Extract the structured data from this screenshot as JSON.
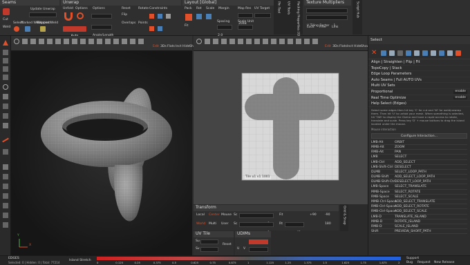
{
  "top": {
    "seams": {
      "title": "Seams",
      "labels": [
        "Cut",
        "Update Unwrap",
        "Disabled",
        "Weld",
        "Select",
        "Marked Weld",
        "Mapped Weld"
      ]
    },
    "unwrap": {
      "title": "Unwrap",
      "labels": [
        "Unfold",
        "Options",
        "Options",
        "Auto",
        "Angle/Length",
        "Reset",
        "Flip",
        "Overlaps",
        "Rotate",
        "Points",
        "Constraints"
      ]
    },
    "layout": {
      "title": "Layout [Global]",
      "labels": [
        "Pack",
        "Rot",
        "Scale",
        "Margin",
        "Map Res",
        "UV Target",
        "Fit",
        "Spacing",
        "Scale Unit",
        "2048",
        "2.0"
      ]
    },
    "texture": {
      "title": "Texture Multipliers",
      "labels": [
        "U Tiling Factor",
        "1",
        "V Tiling Factor",
        "1",
        "Lock",
        "Free",
        "Link"
      ]
    },
    "vertical_tabs": [
      "Pin Tool",
      "UV Tools",
      "Packing Properties [Gl",
      "Script Hub"
    ]
  },
  "viewport3d": {
    "toolbar": [
      "Edit",
      "3Ds",
      "Flats",
      "Inct",
      "Hide",
      "Show"
    ],
    "label_x": "X",
    "label_y": "Y"
  },
  "viewportuv": {
    "toolbar": [
      "Edit",
      "3Ds",
      "Flats",
      "Inct",
      "Hide",
      "Show"
    ],
    "tile_label": "Tile u1 v1 1001"
  },
  "transform": {
    "title": "Transform",
    "row1": [
      "Local",
      "Center",
      "Mouse",
      "Sc",
      "0",
      "Fit",
      "+90",
      "-90"
    ],
    "row2": [
      "World",
      "Multi",
      "User",
      "Sc",
      "0",
      "Rt",
      "45",
      "180"
    ]
  },
  "uvtile": {
    "title": "UV Tile",
    "labels": [
      "Su",
      "1",
      "Sv",
      "1",
      "Reset"
    ]
  },
  "udims": {
    "title": "UDIMs",
    "labels": [
      "Relocate",
      "1001",
      "U",
      "V"
    ]
  },
  "side_tabs": [
    "Grid & Snap"
  ],
  "select_panel": {
    "title": "Select",
    "rows": [
      "Align | Straighten | Flip | Fit",
      "TopoCopy | Stack",
      "Edge Loop Parameters",
      "Auto Seams | Full AUTO UVs",
      "Multi UV Sets",
      "Proportional",
      "Real Time Optimize",
      "Help Select (Edges)"
    ],
    "enable_labels": [
      "enable",
      "enable"
    ],
    "help_text": "Select some edges then hit key 'C' for cut and 'W' for weld/unwrap them. Then hit 'U' to unfold your mesh. When something is selected, hit 'TAB' to display the Gizmo and have a rapid access to rotate, translate and scale. Press key 'D' + mouse buttons to drag the island located under the mouse.",
    "mouse_hdr": "Mouse interaction",
    "configure": "Configure Interaction...",
    "shortcuts": [
      [
        "LMB-Alt",
        "ORBIT"
      ],
      [
        "MMB-Alt",
        "ZOOM"
      ],
      [
        "RMB-Alt",
        "PAN"
      ],
      [
        "LMB",
        "SELECT"
      ],
      [
        "LMB-Ctrl",
        "ADD_SELECT"
      ],
      [
        "LMB-Shift-Ctrl",
        "DESELECT"
      ],
      [
        "DLMB",
        "SELECT_LOOP_PATH"
      ],
      [
        "DLMB-Shift",
        "ADD_SELECT_LOOP_PATH"
      ],
      [
        "DLMB-Shift-Ctrl",
        "DESELECT_LOOP_PATH"
      ],
      [
        "LMB-Space",
        "SELECT_TRANSLATE"
      ],
      [
        "MMB-Space",
        "SELECT_ROTATE"
      ],
      [
        "RMB-Space",
        "SELECT_SCALE"
      ],
      [
        "MMB-Ctrl-Space",
        "ADD_SELECT_TRANSLATE"
      ],
      [
        "RMB-Ctrl-Space",
        "ADD_SELECT_ROTATE"
      ],
      [
        "RMB-Ctrl-Space",
        "ADD_SELECT_SCALE"
      ],
      [
        "LMB-D",
        "TRANSLATE_ISLAND"
      ],
      [
        "MMB-D",
        "ROTATE_ISLAND"
      ],
      [
        "RMB-D",
        "SCALE_ISLAND"
      ],
      [
        "Shift",
        "PREVIEW_SHORT_PATH"
      ]
    ]
  },
  "status": {
    "mode": "EDGES",
    "info": "Selected: 0 | Hidden: 0 | Total: 77214",
    "stretch": "Island Stretch",
    "scale": [
      "0",
      "0.125",
      "0.25",
      "0.375",
      "0.5",
      "0.625",
      "0.75",
      "0.875",
      "1",
      "1.125",
      "1.25",
      "1.375",
      "1.5",
      "1.625",
      "1.75",
      "1.875",
      "2"
    ],
    "right": [
      "Support",
      "Bug",
      "Request",
      "New Release"
    ]
  },
  "colors": {
    "accent": "#e0502a",
    "bg": "#2b2b2b",
    "viewport": "#202020",
    "uvbg": "#3d3d3d",
    "mesh": "#8e8e8e"
  }
}
